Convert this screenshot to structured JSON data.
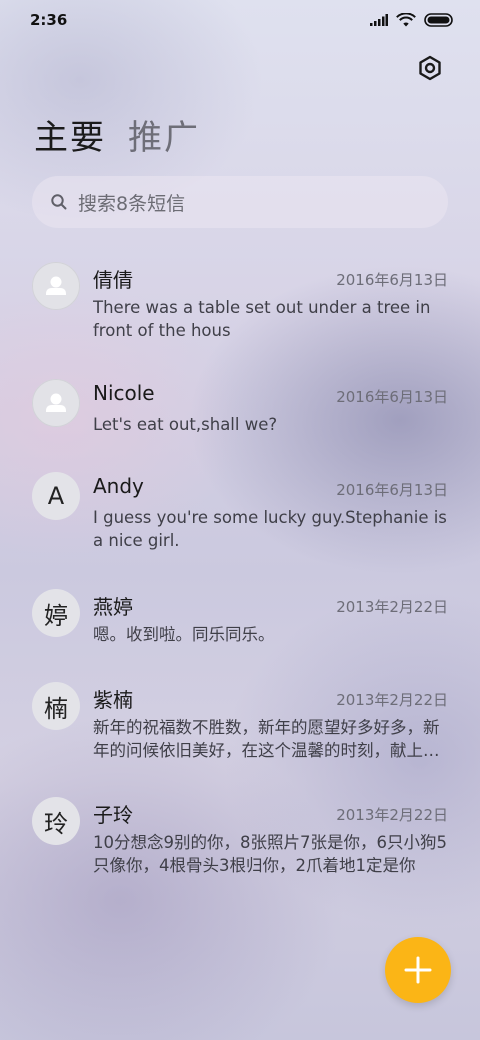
{
  "status_bar": {
    "time": "2:36",
    "icons": [
      "signal-icon",
      "wifi-icon",
      "battery-icon"
    ]
  },
  "header": {
    "settings_icon": "settings-icon"
  },
  "tabs": [
    {
      "label": "主要",
      "active": true
    },
    {
      "label": "推广",
      "active": false
    }
  ],
  "search": {
    "placeholder": "搜索8条短信",
    "icon": "search-icon"
  },
  "conversations": [
    {
      "name": "倩倩",
      "avatar": "",
      "date": "2016年6月13日",
      "preview": "There was a table set out under a tree in front of the hous"
    },
    {
      "name": "Nicole",
      "avatar": "",
      "date": "2016年6月13日",
      "preview": "Let's eat out,shall we?"
    },
    {
      "name": "Andy",
      "avatar": "A",
      "date": "2016年6月13日",
      "preview": "I guess you're some lucky guy.Stephanie is a nice girl."
    },
    {
      "name": "燕婷",
      "avatar": "婷",
      "date": "2013年2月22日",
      "preview": "嗯。收到啦。同乐同乐。"
    },
    {
      "name": "紫楠",
      "avatar": "楠",
      "date": "2013年2月22日",
      "preview": "新年的祝福数不胜数，新年的愿望好多好多，新年的问候依旧美好，在这个温馨的时刻，献上我最真诚的祝福"
    },
    {
      "name": "子玲",
      "avatar": "玲",
      "date": "2013年2月22日",
      "preview": "10分想念9别的你，8张照片7张是你，6只小狗5只像你，4根骨头3根归你，2爪着地1定是你"
    }
  ],
  "fab": {
    "icon": "plus-icon",
    "color": "#fbb516"
  }
}
